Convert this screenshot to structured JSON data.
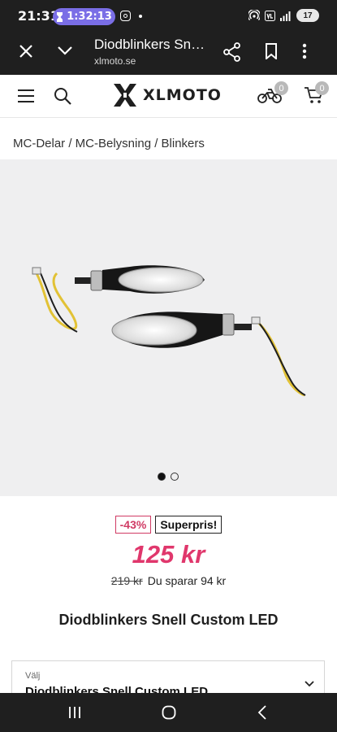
{
  "status_bar": {
    "time": "21:31",
    "timer": "1:32:13",
    "battery": "17"
  },
  "browser": {
    "page_title": "Diodblinkers Snell Custom LED",
    "url": "xlmoto.se"
  },
  "header": {
    "logo_text": "XLMOTO",
    "garage_count": "0",
    "cart_count": "0"
  },
  "breadcrumb": "MC-Delar / MC-Belysning / Blinkers",
  "gallery": {
    "slide_count": 2,
    "active_slide": 1
  },
  "product": {
    "discount_badge": "-43%",
    "superpris_badge": "Superpris!",
    "price": "125 kr",
    "old_price": "219 kr",
    "savings_text": "Du sparar 94 kr",
    "title": "Diodblinkers Snell Custom LED"
  },
  "variant": {
    "label": "Välj",
    "value": "Diodblinkers Snell Custom LED"
  },
  "colors": {
    "accent": "#e0376c",
    "system_bar": "#1f1f1f",
    "timer_pill": "#7a6ee6"
  }
}
